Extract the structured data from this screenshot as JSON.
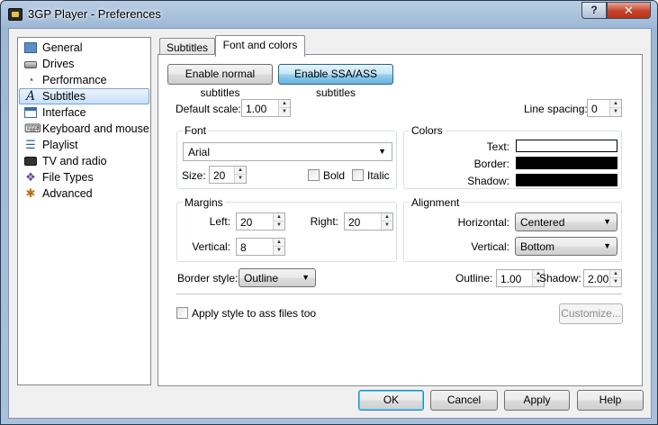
{
  "window": {
    "title": "3GP Player - Preferences",
    "help_glyph": "?",
    "close_glyph": "✕"
  },
  "sidebar": {
    "items": [
      {
        "label": "General",
        "icon": "general-icon"
      },
      {
        "label": "Drives",
        "icon": "drive-icon"
      },
      {
        "label": "Performance",
        "icon": "performance-icon"
      },
      {
        "label": "Subtitles",
        "icon": "subtitles-icon",
        "selected": true
      },
      {
        "label": "Interface",
        "icon": "interface-icon"
      },
      {
        "label": "Keyboard and mouse",
        "icon": "keyboard-icon"
      },
      {
        "label": "Playlist",
        "icon": "playlist-icon"
      },
      {
        "label": "TV and radio",
        "icon": "tv-icon"
      },
      {
        "label": "File Types",
        "icon": "file-types-icon"
      },
      {
        "label": "Advanced",
        "icon": "advanced-icon"
      }
    ]
  },
  "tabs": [
    {
      "label": "Subtitles",
      "active": false
    },
    {
      "label": "Font and colors",
      "active": true
    }
  ],
  "mode_buttons": {
    "normal": "Enable normal subtitles",
    "ssa": "Enable SSA/ASS subtitles"
  },
  "scale": {
    "label": "Default scale:",
    "value": "1.00"
  },
  "line_spacing": {
    "label": "Line spacing:",
    "value": "0"
  },
  "font_group": {
    "title": "Font",
    "font_name": "Arial",
    "size_label": "Size:",
    "size_value": "20",
    "bold_label": "Bold",
    "italic_label": "Italic"
  },
  "colors_group": {
    "title": "Colors",
    "text_label": "Text:",
    "border_label": "Border:",
    "shadow_label": "Shadow:",
    "text_color": "#ffffff",
    "border_color": "#000000",
    "shadow_color": "#000000"
  },
  "margins_group": {
    "title": "Margins",
    "left_label": "Left:",
    "left_value": "20",
    "right_label": "Right:",
    "right_value": "20",
    "vertical_label": "Vertical:",
    "vertical_value": "8"
  },
  "alignment_group": {
    "title": "Alignment",
    "horizontal_label": "Horizontal:",
    "horizontal_value": "Centered",
    "vertical_label": "Vertical:",
    "vertical_value": "Bottom"
  },
  "border_style": {
    "label": "Border style:",
    "value": "Outline"
  },
  "outline": {
    "label": "Outline:",
    "value": "1.00"
  },
  "shadow": {
    "label": "Shadow:",
    "value": "2.00"
  },
  "apply_ass": {
    "label": "Apply style to ass files too"
  },
  "customize_button": "Customize...",
  "footer": {
    "ok": "OK",
    "cancel": "Cancel",
    "apply": "Apply",
    "help": "Help"
  }
}
